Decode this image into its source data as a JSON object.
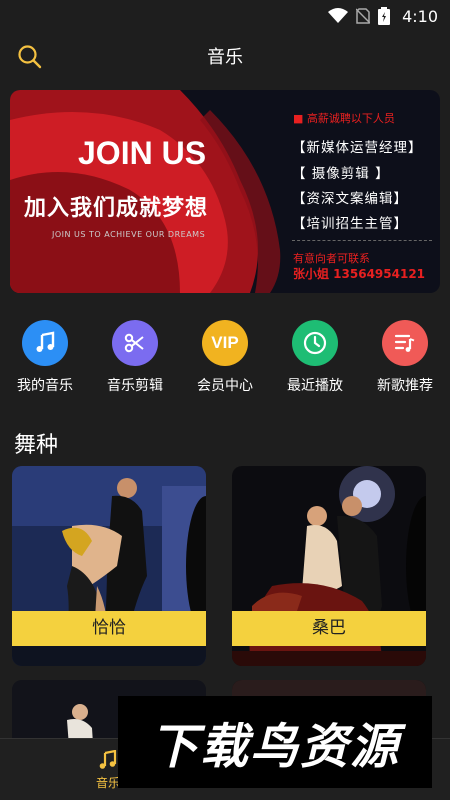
{
  "status_bar": {
    "time": "4:10"
  },
  "header": {
    "title": "音乐"
  },
  "banner": {
    "headline": "JOIN US",
    "slogan": "加入我们成就梦想",
    "slogan_en": "JOIN US TO ACHIEVE OUR DREAMS",
    "hiring_note": "■ 高薪诚聘以下人员",
    "positions": [
      "【新媒体运营经理】",
      "【 摄像剪辑 】",
      "【资深文案编辑】",
      "【培训招生主管】"
    ],
    "contact_note": "有意向者可联系",
    "contact_phone": "张小姐 13564954121"
  },
  "quick_menu": [
    {
      "label": "我的音乐",
      "icon": "music-note-icon",
      "color": "#2c8ff5"
    },
    {
      "label": "音乐剪辑",
      "icon": "scissors-icon",
      "color": "#7b6cf0"
    },
    {
      "label": "会员中心",
      "icon": "vip-icon",
      "color": "#f1b320",
      "icon_text": "VIP"
    },
    {
      "label": "最近播放",
      "icon": "clock-icon",
      "color": "#1ebd74"
    },
    {
      "label": "新歌推荐",
      "icon": "playlist-icon",
      "color": "#f05a57"
    }
  ],
  "section": {
    "title": "舞种"
  },
  "cards": [
    {
      "caption": "恰恰"
    },
    {
      "caption": "桑巴"
    }
  ],
  "tabbar": {
    "active_label": "音乐"
  },
  "watermark": {
    "text": "下载鸟资源"
  },
  "colors": {
    "background": "#1e1e1e",
    "accent": "#f4d13e"
  }
}
